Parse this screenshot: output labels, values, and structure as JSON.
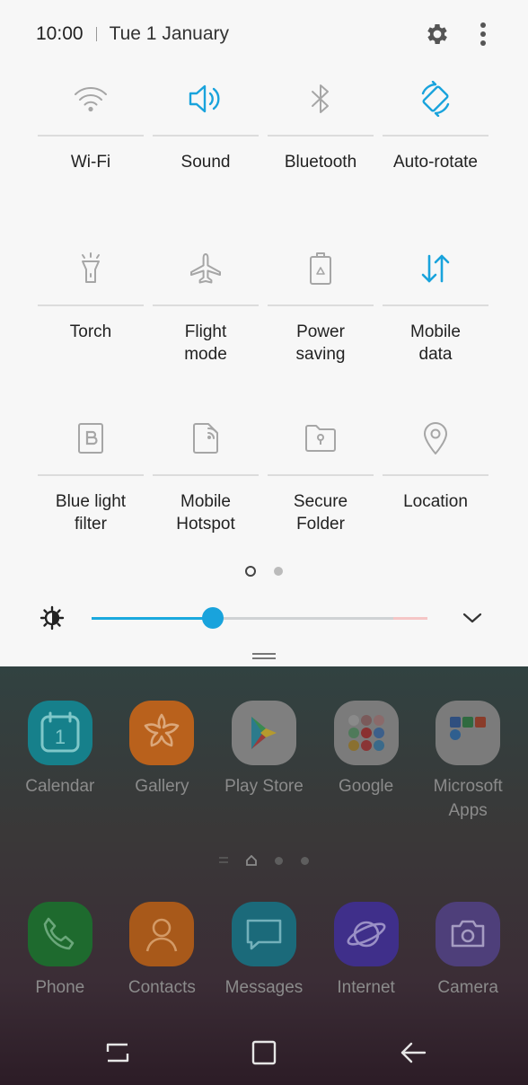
{
  "status_bar": {
    "time": "10:00",
    "date": "Tue 1 January"
  },
  "colors": {
    "accent": "#19a3dc",
    "inactive_icon": "#a6a6a6",
    "panel_bg": "#f7f7f7"
  },
  "quick_settings": {
    "tiles": [
      {
        "label": "Wi-Fi",
        "icon": "wifi-icon",
        "active": false
      },
      {
        "label": "Sound",
        "icon": "sound-icon",
        "active": true
      },
      {
        "label": "Bluetooth",
        "icon": "bluetooth-icon",
        "active": false
      },
      {
        "label": "Auto-rotate",
        "icon": "auto-rotate-icon",
        "active": true
      },
      {
        "label": "Torch",
        "icon": "torch-icon",
        "active": false
      },
      {
        "label": "Flight\nmode",
        "icon": "flight-mode-icon",
        "active": false
      },
      {
        "label": "Power\nsaving",
        "icon": "power-saving-icon",
        "active": false
      },
      {
        "label": "Mobile\ndata",
        "icon": "mobile-data-icon",
        "active": true
      },
      {
        "label": "Blue light\nfilter",
        "icon": "blue-light-filter-icon",
        "active": false
      },
      {
        "label": "Mobile\nHotspot",
        "icon": "mobile-hotspot-icon",
        "active": false
      },
      {
        "label": "Secure\nFolder",
        "icon": "secure-folder-icon",
        "active": false
      },
      {
        "label": "Location",
        "icon": "location-icon",
        "active": false
      }
    ],
    "page_count": 2,
    "current_page": 1
  },
  "brightness": {
    "level_percent": 36
  },
  "home": {
    "apps": [
      {
        "label": "Calendar",
        "icon": "calendar-icon"
      },
      {
        "label": "Gallery",
        "icon": "gallery-icon"
      },
      {
        "label": "Play Store",
        "icon": "play-store-icon"
      },
      {
        "label": "Google",
        "icon": "google-folder-icon"
      },
      {
        "label": "Microsoft\nApps",
        "icon": "microsoft-folder-icon"
      }
    ],
    "dock": [
      {
        "label": "Phone",
        "icon": "phone-icon"
      },
      {
        "label": "Contacts",
        "icon": "contacts-icon"
      },
      {
        "label": "Messages",
        "icon": "messages-icon"
      },
      {
        "label": "Internet",
        "icon": "internet-icon"
      },
      {
        "label": "Camera",
        "icon": "camera-icon"
      }
    ],
    "calendar_day": "1"
  }
}
